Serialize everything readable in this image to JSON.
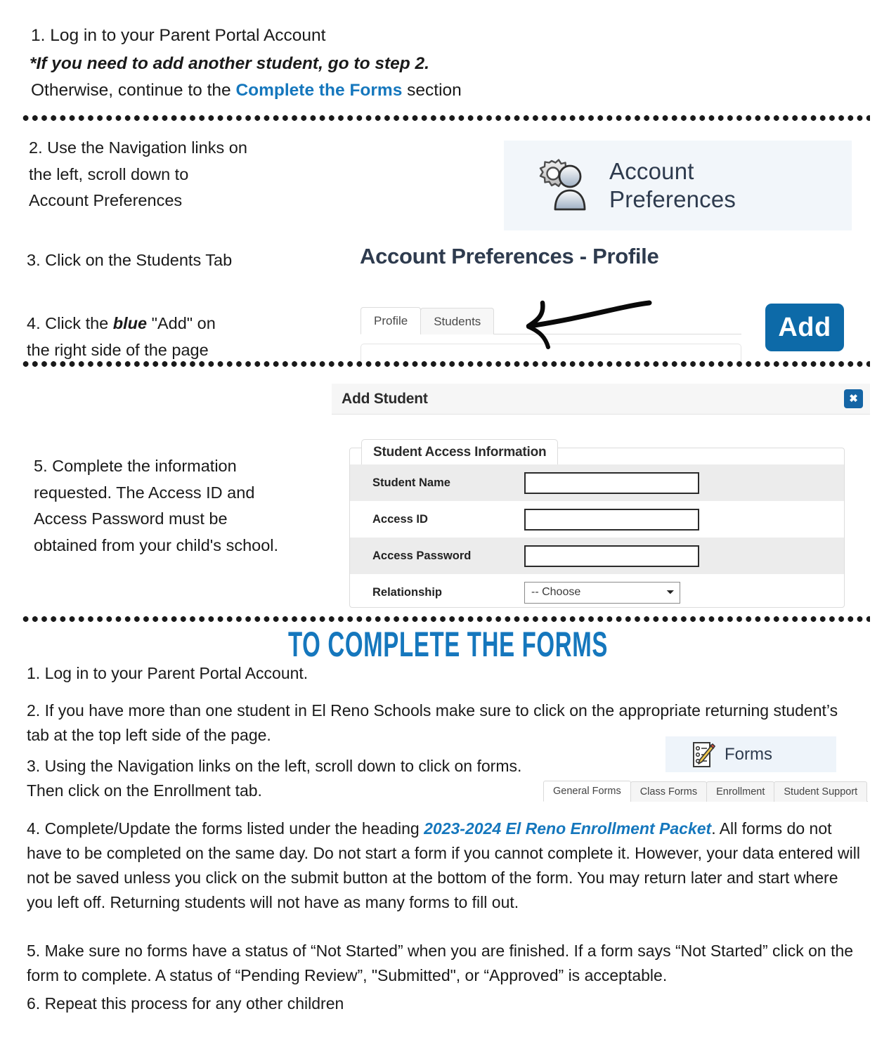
{
  "top_steps": {
    "line1": "1. Log in to your Parent Portal Account",
    "line2": "*If you need to add another student, go to step 2.",
    "line3_pre": "Otherwise, continue to the ",
    "line3_link": "Complete the Forms",
    "line3_post": " section"
  },
  "step2": {
    "line1": "2. Use the Navigation links on",
    "line2": "the left, scroll down to",
    "line3": "Account Preferences"
  },
  "step3": "3. Click on the Students Tab",
  "step4": {
    "pre": "4. Click the ",
    "emph": "blue",
    "post": " \"Add\" on",
    "line2": "the right side of the page"
  },
  "step5": {
    "line1": "5. Complete the information",
    "line2": "requested. The Access ID and",
    "line3": "Access Password must be",
    "line4": "obtained from your child's school."
  },
  "nav_card": {
    "icon": "gear-person-icon",
    "label_line1": "Account",
    "label_line2": "Preferences"
  },
  "account_preferences": {
    "heading": "Account Preferences - Profile",
    "tabs": [
      {
        "label": "Profile",
        "active": true
      },
      {
        "label": "Students",
        "active": false
      }
    ],
    "add_button": "Add",
    "arrow": "left-arrow-annotation"
  },
  "add_student_dialog": {
    "title": "Add Student",
    "close_icon": "close-icon",
    "close_label": "✖",
    "fieldset_legend": "Student Access Information",
    "fields": [
      {
        "label": "Student Name",
        "type": "text",
        "value": "",
        "shaded": true
      },
      {
        "label": "Access ID",
        "type": "text",
        "value": "",
        "shaded": false
      },
      {
        "label": "Access Password",
        "type": "text",
        "value": "",
        "shaded": true
      },
      {
        "label": "Relationship",
        "type": "select",
        "value": "-- Choose",
        "shaded": false
      }
    ]
  },
  "forms_section": {
    "banner": "TO COMPLETE THE FORMS",
    "items": {
      "item1": "1. Log in to your Parent Portal Account.",
      "item2": "2. If you have more than one student in El Reno Schools make sure to click on the appropriate returning student’s tab at the top left side of the page.",
      "item3_line1": "3. Using the Navigation links on the left, scroll down to click on forms.",
      "item3_line2": "Then click on the Enrollment tab.",
      "item4_pre": "4. Complete/Update the forms listed under the heading ",
      "item4_hl": "2023-2024 El Reno Enrollment Packet",
      "item4_post": ".  All forms do not have to be completed on the same day. Do not start a form if you cannot complete it. However, your data entered will not be saved unless you click on the submit button at the bottom of the form.  You may return later and start where you left off.  Returning students will not have as many forms to fill out.",
      "item5": "5. Make sure no forms have a status of “Not Started” when you are finished.  If a form says “Not Started” click on the form to complete.  A status of “Pending Review”, \"Submitted\", or “Approved” is acceptable.",
      "item6": "6. Repeat this process for any other children"
    },
    "forms_card": {
      "icon": "clipboard-pencil-icon",
      "label": "Forms"
    },
    "tabs": [
      {
        "label": "General Forms",
        "active": true
      },
      {
        "label": "Class Forms",
        "active": false
      },
      {
        "label": "Enrollment",
        "active": false
      },
      {
        "label": "Student Support",
        "active": false
      }
    ]
  },
  "colors": {
    "accent_blue": "#1577bd",
    "button_blue": "#0d6aa8",
    "nav_card_bg": "#f2f6fa",
    "heading_dark": "#2e3b4e"
  }
}
